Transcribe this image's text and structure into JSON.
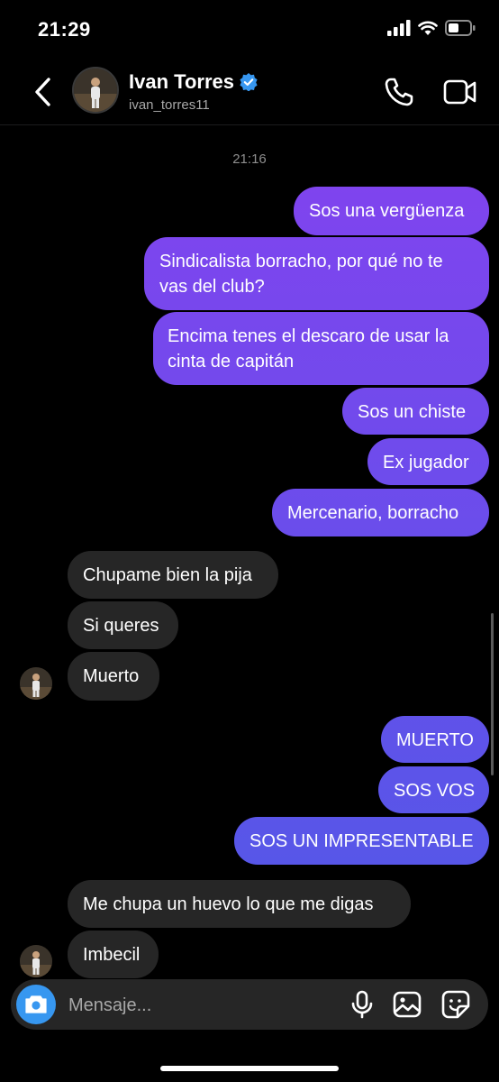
{
  "status_bar": {
    "time": "21:29"
  },
  "header": {
    "name": "Ivan Torres",
    "handle": "ivan_torres11",
    "verified": true
  },
  "conversation": {
    "timestamp": "21:16",
    "messages": [
      {
        "dir": "out",
        "text": "Sos una vergüenza"
      },
      {
        "dir": "out",
        "text": "Sindicalista borracho, por qué no te vas del club?"
      },
      {
        "dir": "out",
        "text": "Encima tenes el descaro de usar la cinta de capitán"
      },
      {
        "dir": "out",
        "text": "Sos un chiste"
      },
      {
        "dir": "out",
        "text": "Ex jugador"
      },
      {
        "dir": "out",
        "text": "Mercenario, borracho"
      },
      {
        "dir": "in",
        "text": "Chupame bien la pija"
      },
      {
        "dir": "in",
        "text": "Si queres"
      },
      {
        "dir": "in",
        "text": "Muerto"
      },
      {
        "dir": "out",
        "text": "MUERTO"
      },
      {
        "dir": "out",
        "text": "SOS VOS"
      },
      {
        "dir": "out",
        "text": "SOS UN IMPRESENTABLE"
      },
      {
        "dir": "in",
        "text": "Me chupa un huevo lo que me digas"
      },
      {
        "dir": "in",
        "text": "Imbecil"
      }
    ]
  },
  "composer": {
    "placeholder": "Mensaje..."
  },
  "colors": {
    "accent": "#3797f0",
    "incoming_bubble": "#262626",
    "gradient_top": "#8a3ff0",
    "gradient_bottom": "#4a5ce6"
  }
}
